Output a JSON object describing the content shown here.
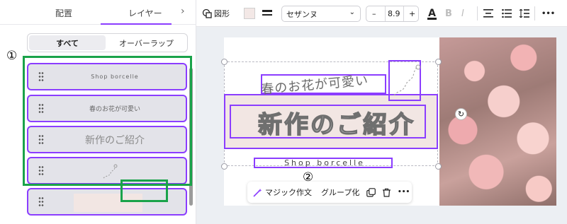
{
  "panel": {
    "tabs": [
      "配置",
      "レイヤー"
    ],
    "active_tab": "レイヤー",
    "filter": {
      "all": "すべて",
      "overlap": "オーバーラップ"
    },
    "layers": [
      {
        "label": "Shop borcelle"
      },
      {
        "label": "春のお花が可愛い"
      },
      {
        "label": "新作のご紹介"
      },
      {
        "label": ""
      },
      {
        "label": ""
      }
    ]
  },
  "annotations": {
    "one": "①",
    "two": "②"
  },
  "toolbar": {
    "shape_label": "図形",
    "font_name": "セザンヌ",
    "font_size": "8.9",
    "minus": "–",
    "plus": "+",
    "text_color_glyph": "A",
    "bold_glyph": "B",
    "italic_glyph": "I",
    "more": "•••"
  },
  "canvas": {
    "spring_text": "春のお花が可愛い",
    "title_text": "新作のご紹介",
    "shop_text": "Shop borcelle"
  },
  "context_bar": {
    "magic": "マジック作文",
    "group": "グループ化",
    "more": "•••"
  },
  "colors": {
    "accent": "#8b3dff",
    "annotation_green": "#1aa34a",
    "beige": "#f2e6e3"
  }
}
